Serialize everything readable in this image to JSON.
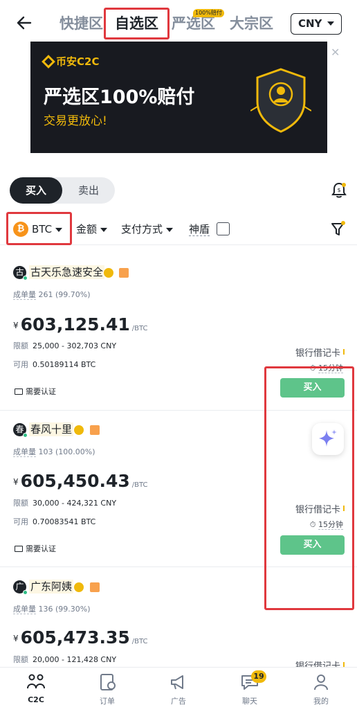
{
  "header": {
    "tabs": [
      {
        "label": "快捷区",
        "active": false
      },
      {
        "label": "自选区",
        "active": true
      },
      {
        "label": "严选区",
        "active": false,
        "badge": "100%赔付"
      },
      {
        "label": "大宗区",
        "active": false
      }
    ],
    "currency": "CNY"
  },
  "banner": {
    "brand": "币安C2C",
    "title": "严选区100%赔付",
    "subtitle": "交易更放心!"
  },
  "toggle": {
    "buy": "买入",
    "sell": "卖出"
  },
  "filters": {
    "coin_symbol": "₿",
    "coin": "BTC",
    "amount": "金额",
    "payment": "支付方式",
    "shendun": "神盾"
  },
  "listings": [
    {
      "avatar": "古",
      "name": "古天乐急速安全",
      "orders_label": "成单量",
      "orders": "261 (99.70%)",
      "currency_symbol": "¥",
      "price": "603,125.41",
      "unit": "/BTC",
      "limit_label": "限额",
      "limit": "25,000 - 302,703 CNY",
      "avail_label": "可用",
      "avail": "0.50189114 BTC",
      "verify": "需要认证",
      "payment": "银行借记卡",
      "time": "15分钟",
      "button": "买入"
    },
    {
      "avatar": "春",
      "name": "春风十里",
      "orders_label": "成单量",
      "orders": "103 (100.00%)",
      "currency_symbol": "¥",
      "price": "605,450.43",
      "unit": "/BTC",
      "limit_label": "限额",
      "limit": "30,000 - 424,321 CNY",
      "avail_label": "可用",
      "avail": "0.70083541 BTC",
      "verify": "需要认证",
      "payment": "银行借记卡",
      "time": "15分钟",
      "button": "买入"
    },
    {
      "avatar": "广",
      "name": "广东阿姨",
      "orders_label": "成单量",
      "orders": "136 (99.30%)",
      "currency_symbol": "¥",
      "price": "605,473.35",
      "unit": "/BTC",
      "limit_label": "限额",
      "limit": "20,000 - 121,428 CNY",
      "payment": "银行借记卡"
    }
  ],
  "bottom_nav": [
    {
      "label": "C2C",
      "icon": "users-icon",
      "active": true
    },
    {
      "label": "订单",
      "icon": "orders-icon",
      "active": false
    },
    {
      "label": "广告",
      "icon": "megaphone-icon",
      "active": false
    },
    {
      "label": "聊天",
      "icon": "chat-icon",
      "active": false,
      "badge": "19"
    },
    {
      "label": "我的",
      "icon": "profile-icon",
      "active": false
    }
  ],
  "colors": {
    "accent": "#f0b90b",
    "buy_green": "#5ec48a",
    "highlight_red": "#e0383e"
  }
}
